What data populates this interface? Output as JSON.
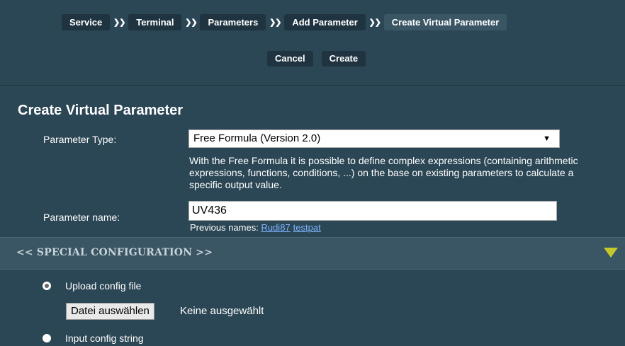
{
  "breadcrumb": {
    "items": [
      "Service",
      "Terminal",
      "Parameters",
      "Add Parameter",
      "Create Virtual Parameter"
    ],
    "separator": "❯❯"
  },
  "actions": {
    "cancel": "Cancel",
    "create": "Create"
  },
  "form": {
    "title": "Create Virtual Parameter",
    "parameter_type_label": "Parameter Type:",
    "parameter_type_value": "Free Formula (Version 2.0)",
    "dropdown_arrow": "▼",
    "description": "With the Free Formula it is possible to define complex expressions (containing arithmetic expressions, functions, conditions, ...) on the base on existing parameters to calculate a specific output value.",
    "parameter_name_label": "Parameter name:",
    "parameter_name_value": "UV436",
    "previous_names_label": "Previous names:",
    "previous_names": [
      "Rudi87",
      "testpat"
    ]
  },
  "special_config": {
    "header": "<<  SPECIAL CONFIGURATION  >>",
    "toggle_icon": "triangle-down-icon",
    "accent_color": "#c4c92a",
    "upload_label": "Upload config file",
    "upload_selected": true,
    "file_button": "Datei auswählen",
    "file_status": "Keine ausgewählt",
    "input_label": "Input config string",
    "input_selected": false
  }
}
